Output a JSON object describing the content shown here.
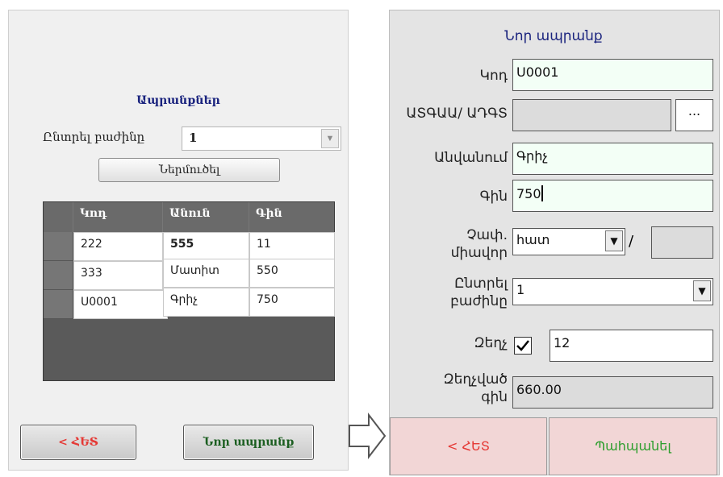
{
  "left": {
    "title": "Ապրանքներ",
    "department_label": "Ընտրել բաժինը",
    "department_value": "1",
    "import_button": "Ներմուծել",
    "table": {
      "headers": [
        "Կոդ",
        "Անուն",
        "Գին"
      ],
      "rows": [
        {
          "code": "222",
          "name": "555",
          "price": "11"
        },
        {
          "code": "333",
          "name": "Մատիտ",
          "price": "550"
        },
        {
          "code": "Ս0001",
          "name": "Գրիչ",
          "price": "750"
        }
      ]
    },
    "back_button": "< ՀԵՏ",
    "new_product_button": "Նոր ապրանք"
  },
  "right": {
    "title": "Նոր ապրանք",
    "code_label": "Կոդ",
    "code_value": "Ս0001",
    "classifier_label": "ԱՏԳԱԱ/ ԱԴԳՏ",
    "classifier_value": "",
    "browse_button": "...",
    "name_label": "Անվանում",
    "name_value": "Գրիչ",
    "price_label": "Գին",
    "price_value": "750",
    "unit_label": "Չափ. միավոր",
    "unit_value": "հատ",
    "unit_separator": "/",
    "unit_extra_value": "",
    "department_label": "Ընտրել բաժինը",
    "department_value": "1",
    "discount_label": "Զեղչ",
    "discount_checked": true,
    "discount_value": "12",
    "discounted_price_label": "Զեղչված գին",
    "discounted_price_value": "660.00",
    "back_button": "< ՀԵՏ",
    "save_button": "Պահպանել"
  }
}
